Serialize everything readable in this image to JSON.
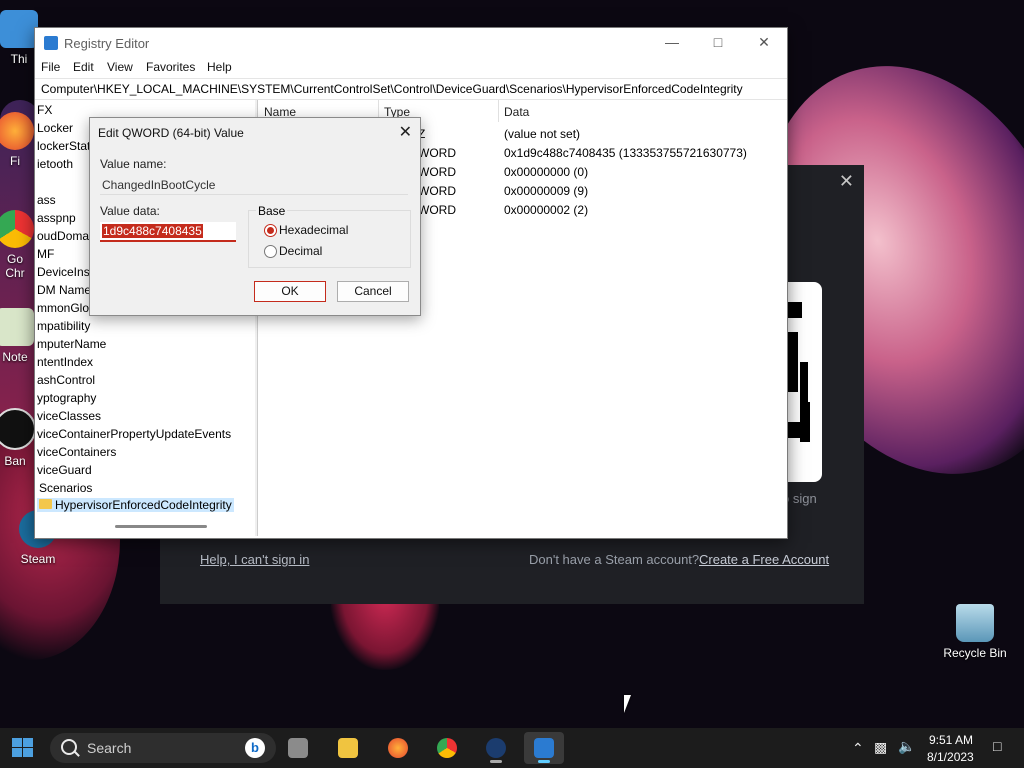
{
  "desktop": {
    "icons": [
      {
        "label": "Thi"
      },
      {
        "label": "Fi"
      },
      {
        "label": "Go\nChr"
      },
      {
        "label": "Note"
      },
      {
        "label": "Ban"
      },
      {
        "label": "Steam"
      },
      {
        "label": "Recycle Bin"
      }
    ]
  },
  "steam_dialog": {
    "close": "✕",
    "sign_in_text": "o sign",
    "help_link": "Help, I can't sign in",
    "no_account": "Don't have a Steam account?",
    "create_link": "Create a Free Account"
  },
  "regedit": {
    "title": "Registry Editor",
    "menu": [
      "File",
      "Edit",
      "View",
      "Favorites",
      "Help"
    ],
    "address": "Computer\\HKEY_LOCAL_MACHINE\\SYSTEM\\CurrentControlSet\\Control\\DeviceGuard\\Scenarios\\HypervisorEnforcedCodeIntegrity",
    "tree": [
      "FX",
      "Locker",
      "lockerStat",
      "ietooth",
      "",
      "ass",
      "asspnp",
      "oudDomai",
      "MF",
      "DeviceInst",
      "DM Name",
      "mmonGlo",
      "mpatibility",
      "mputerName",
      "ntentIndex",
      "ashControl",
      "yptography",
      "viceClasses",
      "viceContainerPropertyUpdateEvents",
      "viceContainers",
      "viceGuard",
      "Scenarios",
      "HypervisorEnforcedCodeIntegrity"
    ],
    "columns": {
      "name": "Name",
      "type": "Type",
      "data": "Data"
    },
    "rows": [
      {
        "type": "Z",
        "data": "(value not set)"
      },
      {
        "type": "WORD",
        "data": "0x1d9c488c7408435 (133353755721630773)"
      },
      {
        "type": "WORD",
        "data": "0x00000000 (0)"
      },
      {
        "type": "WORD",
        "data": "0x00000009 (9)"
      },
      {
        "type": "WORD",
        "data": "0x00000002 (2)"
      }
    ]
  },
  "edit_dialog": {
    "title": "Edit QWORD (64-bit) Value",
    "close": "✕",
    "value_name_label": "Value name:",
    "value_name": "ChangedInBootCycle",
    "value_data_label": "Value data:",
    "value_data": "1d9c488c7408435",
    "base_label": "Base",
    "hex_label": "Hexadecimal",
    "dec_label": "Decimal",
    "selected_base": "Hexadecimal",
    "ok": "OK",
    "cancel": "Cancel"
  },
  "taskbar": {
    "search_placeholder": "Search",
    "bing": "b",
    "time": "9:51 AM",
    "date": "8/1/2023"
  }
}
